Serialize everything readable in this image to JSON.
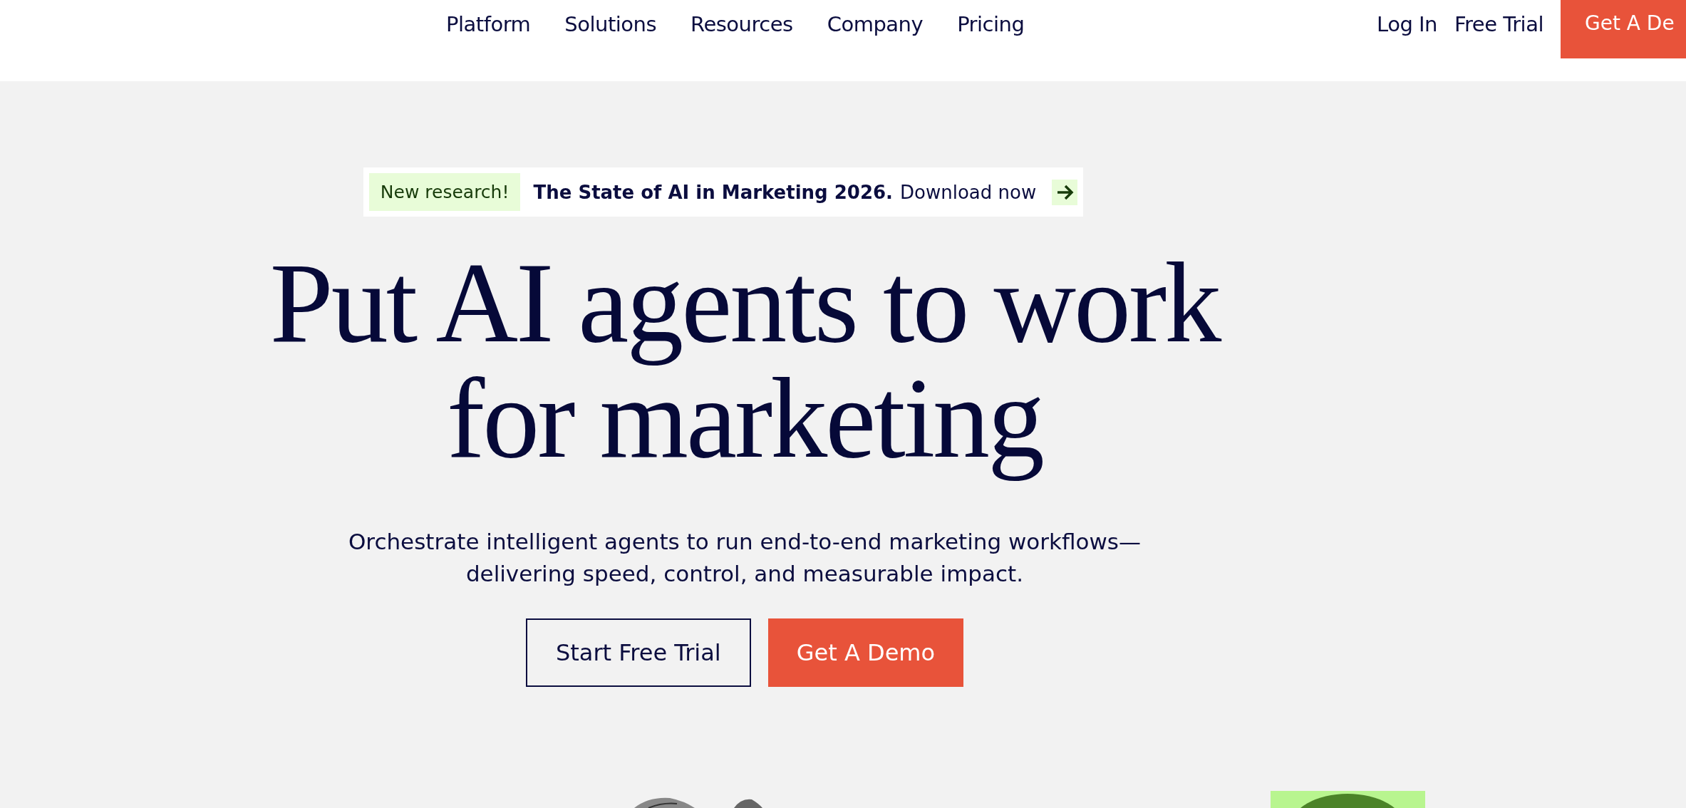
{
  "header": {
    "nav": [
      "Platform",
      "Solutions",
      "Resources",
      "Company",
      "Pricing"
    ],
    "links": [
      "Log In",
      "Free Trial"
    ],
    "cta": "Get A De"
  },
  "banner": {
    "tag": "New research!",
    "title": "The State of AI in Marketing 2026.",
    "action": "Download now"
  },
  "hero": {
    "headline": [
      "Put AI agents to work",
      "for marketing"
    ],
    "subtitle": [
      "Orchestrate intelligent agents to run end-to-end marketing workflows—",
      "delivering speed, control, and measurable impact."
    ],
    "buttons": [
      {
        "label": "Start Free Trial",
        "kind": "outline"
      },
      {
        "label": "Get A Demo",
        "kind": "solid"
      }
    ]
  }
}
